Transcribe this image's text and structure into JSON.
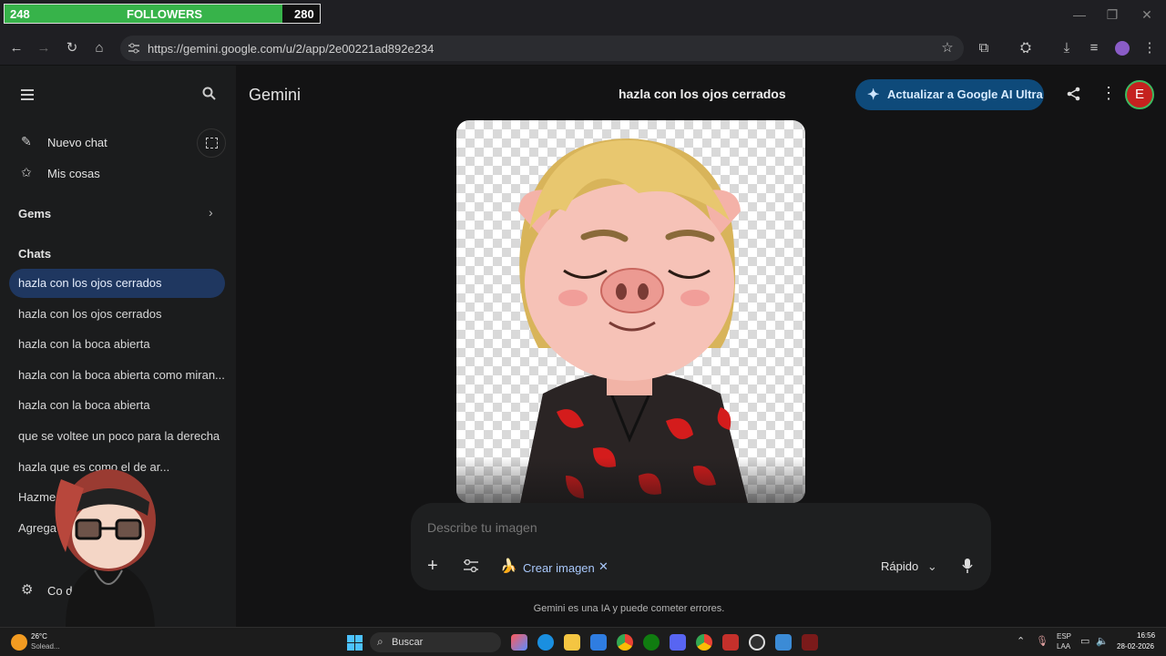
{
  "overlay": {
    "followers_current": "248",
    "followers_label": "FOLLOWERS",
    "followers_goal": "280",
    "progress": 0.886
  },
  "browser": {
    "url": "https://gemini.google.com/u/2/app/2e00221ad892e234"
  },
  "sidebar": {
    "new_chat": "Nuevo chat",
    "my_stuff": "Mis cosas",
    "gems": "Gems",
    "chats_header": "Chats",
    "chats": [
      "hazla con los ojos cerrados",
      "hazla con los ojos cerrados",
      "hazla con la boca abierta",
      "hazla con la boca abierta como miran...",
      "hazla con la boca abierta",
      "que se voltee un poco para la derecha",
      "hazla que es        como el de ar...",
      "Hazme            ong mod...",
      "Agrega              ON"
    ],
    "settings_label": "Co                      da"
  },
  "header": {
    "app_name": "Gemini",
    "chat_title": "hazla con los ojos cerrados",
    "upgrade_label": "Actualizar a Google AI Ultra",
    "avatar_letter": "E"
  },
  "composer": {
    "placeholder": "Describe tu imagen",
    "tool_chip": "Crear imagen",
    "mode": "Rápido"
  },
  "disclaimer": "Gemini es una IA y puede cometer errores.",
  "taskbar": {
    "weather_temp": "26°C",
    "weather_desc": "Solead...",
    "search_label": "Buscar",
    "lang_top": "ESP",
    "lang_bottom": "LAA",
    "time": "16:56",
    "date": "28-02-2026"
  },
  "colors": {
    "accent": "#1f3760",
    "upgrade_bg": "#0e4a7a",
    "avatar_bg": "#c5221f",
    "followers_bar": "#37b34a"
  }
}
